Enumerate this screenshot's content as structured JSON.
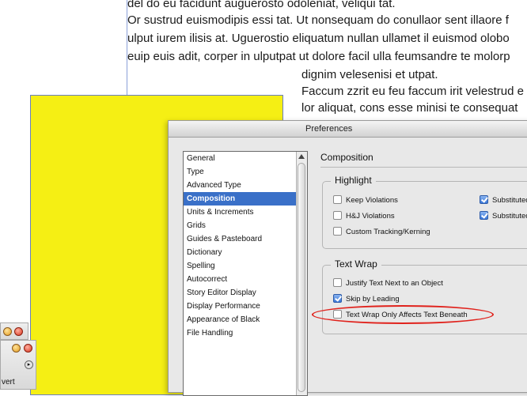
{
  "document": {
    "lines_wide": [
      "del do eu facidunt auguerosto odoleniat, veliqui tat.",
      "Or sustrud euismodipis essi tat. Ut nonsequam do conullaor sent illaore f",
      "ulput iurem ilisis at. Uguerostio eliquatum nullan ullamet il euismod olobo",
      "euip euis adit, corper in ulputpat ut dolore facil ulla feumsandre te molorp"
    ],
    "lines_narrow": [
      "dignim velesenisi et utpat.",
      "Faccum zzrit eu feu faccum irit velestrud e",
      "lor aliquat, cons esse minisi te consequat"
    ]
  },
  "mini_panel": {
    "label": "vert"
  },
  "dialog": {
    "title": "Preferences",
    "categories": [
      "General",
      "Type",
      "Advanced Type",
      "Composition",
      "Units & Increments",
      "Grids",
      "Guides & Pasteboard",
      "Dictionary",
      "Spelling",
      "Autocorrect",
      "Story Editor Display",
      "Display Performance",
      "Appearance of Black",
      "File Handling"
    ],
    "selected_category": "Composition",
    "section_title": "Composition",
    "highlight": {
      "label": "Highlight",
      "options": [
        {
          "label": "Keep Violations",
          "checked": false
        },
        {
          "label": "H&J Violations",
          "checked": false
        },
        {
          "label": "Custom Tracking/Kerning",
          "checked": false
        },
        {
          "label": "Substituted",
          "checked": true
        },
        {
          "label": "Substituted",
          "checked": true
        }
      ]
    },
    "text_wrap": {
      "label": "Text Wrap",
      "options": [
        {
          "label": "Justify Text Next to an Object",
          "checked": false
        },
        {
          "label": "Skip by Leading",
          "checked": true
        },
        {
          "label": "Text Wrap Only Affects Text Beneath",
          "checked": false
        }
      ]
    }
  },
  "colors": {
    "page_yellow": "#f5ef14",
    "selection_blue": "#3a70c8",
    "annotation_red": "#e0221c"
  }
}
